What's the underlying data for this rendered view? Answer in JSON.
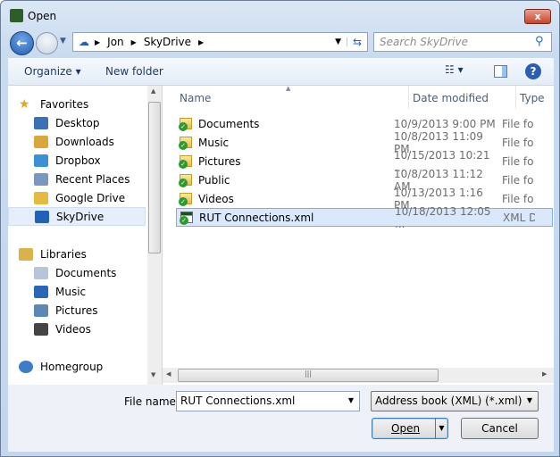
{
  "window": {
    "title": "Open",
    "close_label": "x"
  },
  "address": {
    "segments": [
      "Jon",
      "SkyDrive"
    ]
  },
  "search": {
    "placeholder": "Search SkyDrive"
  },
  "toolbar": {
    "organize": "Organize ▾",
    "new_folder": "New folder"
  },
  "sidebar": {
    "favorites_label": "Favorites",
    "favorites": [
      {
        "label": "Desktop",
        "color": "#3c6fb4"
      },
      {
        "label": "Downloads",
        "color": "#d9a73b"
      },
      {
        "label": "Dropbox",
        "color": "#3d8fd8"
      },
      {
        "label": "Recent Places",
        "color": "#7b97bd"
      },
      {
        "label": "Google Drive",
        "color": "#e3bb3e"
      },
      {
        "label": "SkyDrive",
        "color": "#1f62b7"
      }
    ],
    "libraries_label": "Libraries",
    "libraries": [
      {
        "label": "Documents",
        "color": "#b7c5d8"
      },
      {
        "label": "Music",
        "color": "#2a66b8"
      },
      {
        "label": "Pictures",
        "color": "#5e86b8"
      },
      {
        "label": "Videos",
        "color": "#444"
      }
    ],
    "homegroup_label": "Homegroup"
  },
  "columns": {
    "name": "Name",
    "date": "Date modified",
    "type": "Type"
  },
  "files": [
    {
      "name": "Documents",
      "date": "10/9/2013 9:00 PM",
      "type": "File folder",
      "kind": "folder"
    },
    {
      "name": "Music",
      "date": "10/8/2013 11:09 PM",
      "type": "File folder",
      "kind": "folder"
    },
    {
      "name": "Pictures",
      "date": "10/15/2013 10:21 ...",
      "type": "File folder",
      "kind": "folder"
    },
    {
      "name": "Public",
      "date": "10/8/2013 11:12 AM",
      "type": "File folder",
      "kind": "folder"
    },
    {
      "name": "Videos",
      "date": "10/13/2013 1:16 PM",
      "type": "File folder",
      "kind": "folder"
    },
    {
      "name": "RUT Connections.xml",
      "date": "10/18/2013 12:05 ...",
      "type": "XML Document",
      "kind": "xml",
      "selected": true
    }
  ],
  "footer": {
    "file_name_label": "File name:",
    "file_name_value": "RUT Connections.xml",
    "filter": "Address book (XML) (*.xml)",
    "open": "Open",
    "cancel": "Cancel"
  }
}
